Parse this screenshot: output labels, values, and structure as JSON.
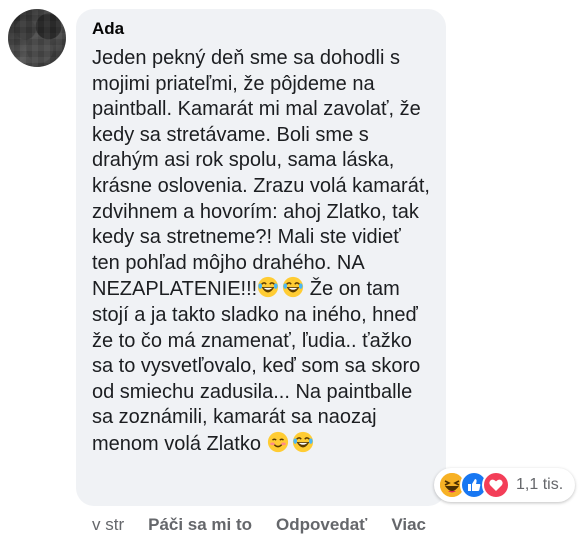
{
  "comment": {
    "author": "Ada",
    "text_part1": "Jeden pekný deň sme sa dohodli s mojimi priateľmi, že pôjdeme na paintball. Kamarát mi mal zavolať, že kedy sa stretávame. Boli sme s drahým asi rok spolu, sama láska, krásne oslovenia. Zrazu volá kamarát, zdvihnem a hovorím: ahoj Zlatko, tak kedy sa stretneme?! Mali ste vidieť ten pohľad môjho drahého. NA NEZAPLATENIE!!!",
    "text_part2": " Že on tam stojí a ja takto sladko na iného, hneď že to čo má znamenať, ľudia.. ťažko sa to vysvetľovalo, keď som sa skoro od smiechu zadusila... Na paintballe sa zoznámili, kamarát sa naozaj menom volá Zlatko ",
    "inline_emojis": [
      "laughing-tears-icon",
      "laughing-tears-icon",
      "smiling-blush-icon",
      "laughing-tears-icon"
    ]
  },
  "reactions": {
    "icons": [
      "haha-reaction-icon",
      "like-reaction-icon",
      "love-reaction-icon"
    ],
    "count": "1,1 tis."
  },
  "actions": {
    "time": "v str",
    "like": "Páči sa mi to",
    "reply": "Odpovedať",
    "more": "Viac"
  },
  "colors": {
    "bubble_bg": "#f0f2f5",
    "text": "#1c1e21",
    "secondary": "#65676b",
    "like_blue": "#1877f2",
    "love_red": "#f33e58",
    "haha_yellow": "#f7b125"
  }
}
